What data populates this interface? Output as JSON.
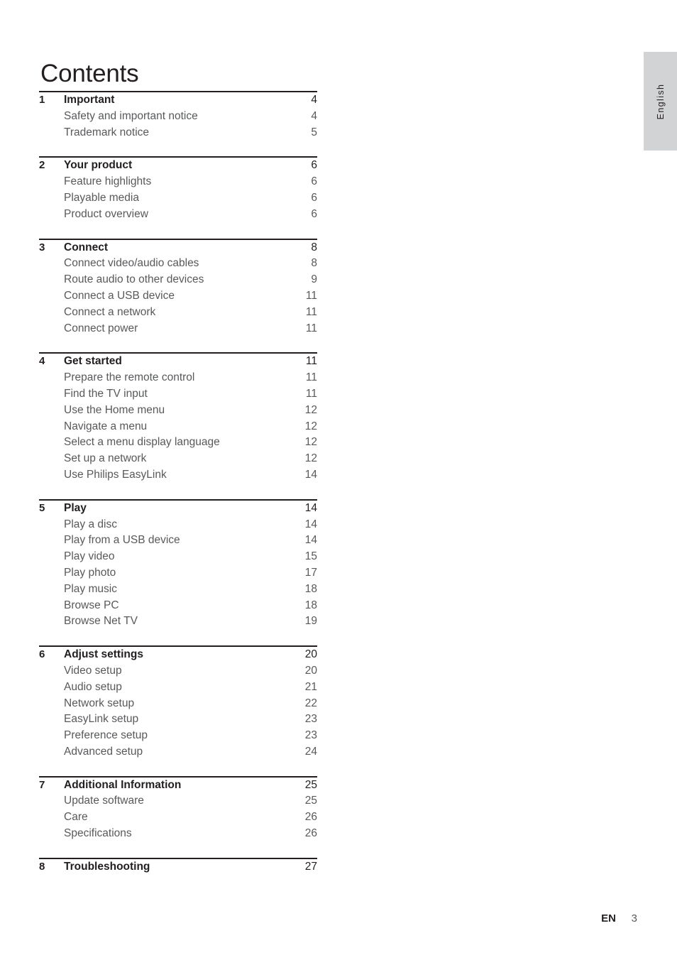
{
  "page_title": "Contents",
  "language_tab": {
    "label": "English"
  },
  "footer": {
    "locale": "EN",
    "page_number": "3"
  },
  "colors": {
    "heading_text": "#231f20",
    "body_text": "#58595b",
    "rule": "#231f20",
    "tab_background": "#d2d3d5"
  },
  "toc": {
    "groups": [
      {
        "number": "1",
        "heading": "Important",
        "heading_page": "4",
        "items": [
          {
            "label": "Safety and important notice",
            "page": "4"
          },
          {
            "label": "Trademark notice",
            "page": "5"
          }
        ]
      },
      {
        "number": "2",
        "heading": "Your product",
        "heading_page": "6",
        "items": [
          {
            "label": "Feature highlights",
            "page": "6"
          },
          {
            "label": "Playable media",
            "page": "6"
          },
          {
            "label": "Product overview",
            "page": "6"
          }
        ]
      },
      {
        "number": "3",
        "heading": "Connect",
        "heading_page": "8",
        "items": [
          {
            "label": "Connect video/audio cables",
            "page": "8"
          },
          {
            "label": "Route audio to other devices",
            "page": "9"
          },
          {
            "label": "Connect a USB device",
            "page": "11"
          },
          {
            "label": "Connect a network",
            "page": "11"
          },
          {
            "label": "Connect power",
            "page": "11"
          }
        ]
      },
      {
        "number": "4",
        "heading": "Get started",
        "heading_page": "11",
        "items": [
          {
            "label": "Prepare the remote control",
            "page": "11"
          },
          {
            "label": "Find the TV input",
            "page": "11"
          },
          {
            "label": "Use the Home menu",
            "page": "12"
          },
          {
            "label": "Navigate a menu",
            "page": "12"
          },
          {
            "label": "Select a menu display language",
            "page": "12"
          },
          {
            "label": "Set up a network",
            "page": "12"
          },
          {
            "label": "Use Philips EasyLink",
            "page": "14"
          }
        ]
      },
      {
        "number": "5",
        "heading": "Play",
        "heading_page": "14",
        "items": [
          {
            "label": "Play a disc",
            "page": "14"
          },
          {
            "label": "Play from a USB device",
            "page": "14"
          },
          {
            "label": "Play video",
            "page": "15"
          },
          {
            "label": "Play photo",
            "page": "17"
          },
          {
            "label": "Play music",
            "page": "18"
          },
          {
            "label": "Browse PC",
            "page": "18"
          },
          {
            "label": "Browse Net TV",
            "page": "19"
          }
        ]
      },
      {
        "number": "6",
        "heading": "Adjust settings",
        "heading_page": "20",
        "items": [
          {
            "label": "Video setup",
            "page": "20"
          },
          {
            "label": "Audio setup",
            "page": "21"
          },
          {
            "label": "Network setup",
            "page": "22"
          },
          {
            "label": "EasyLink setup",
            "page": "23"
          },
          {
            "label": "Preference setup",
            "page": "23"
          },
          {
            "label": "Advanced setup",
            "page": "24"
          }
        ]
      },
      {
        "number": "7",
        "heading": "Additional Information",
        "heading_page": "25",
        "items": [
          {
            "label": "Update software",
            "page": "25"
          },
          {
            "label": "Care",
            "page": "26"
          },
          {
            "label": "Specifications",
            "page": "26"
          }
        ]
      },
      {
        "number": "8",
        "heading": "Troubleshooting",
        "heading_page": "27",
        "items": []
      }
    ]
  }
}
